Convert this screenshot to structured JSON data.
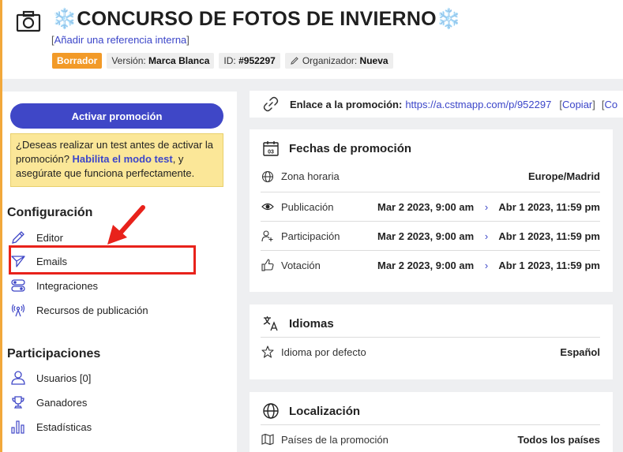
{
  "header": {
    "snow_left": "❄️",
    "title": "CONCURSO DE FOTOS DE INVIERNO",
    "snow_right": "❄️",
    "ref_open": "[",
    "ref_link": "Añadir una referencia interna",
    "ref_close": "]",
    "badges": {
      "draft": "Borrador",
      "version_label": "Versión:",
      "version_value": "Marca Blanca",
      "id_label": "ID:",
      "id_value": "#952297",
      "organizer_label": "Organizador:",
      "organizer_value": "Nueva"
    }
  },
  "sidebar": {
    "activate_label": "Activar promoción",
    "test_note": {
      "before": "¿Deseas realizar un test antes de activar la promoción? ",
      "link": "Habilita el modo test",
      "after": ", y asegúrate que funciona perfectamente."
    },
    "config_title": "Configuración",
    "config_items": [
      {
        "label": "Editor",
        "icon": "pencil-icon"
      },
      {
        "label": "Emails",
        "icon": "paper-plane-icon"
      },
      {
        "label": "Integraciones",
        "icon": "toggles-icon"
      },
      {
        "label": "Recursos de publicación",
        "icon": "broadcast-icon"
      }
    ],
    "participations_title": "Participaciones",
    "participation_items": [
      {
        "label": "Usuarios [0]",
        "icon": "user-icon"
      },
      {
        "label": "Ganadores",
        "icon": "trophy-icon"
      },
      {
        "label": "Estadísticas",
        "icon": "bar-chart-icon"
      }
    ]
  },
  "promo_link": {
    "label": "Enlace a la promoción:",
    "url": "https://a.cstmapp.com/p/952297",
    "copy": "Copiar",
    "extra": "Co"
  },
  "dates_card": {
    "title": "Fechas de promoción",
    "timezone_label": "Zona horaria",
    "timezone_value": "Europe/Madrid",
    "rows": [
      {
        "label": "Publicación",
        "from": "Mar 2 2023, 9:00 am",
        "to": "Abr 1 2023, 11:59 pm",
        "icon": "eye-icon"
      },
      {
        "label": "Participación",
        "from": "Mar 2 2023, 9:00 am",
        "to": "Abr 1 2023, 11:59 pm",
        "icon": "user-add-icon"
      },
      {
        "label": "Votación",
        "from": "Mar 2 2023, 9:00 am",
        "to": "Abr 1 2023, 11:59 pm",
        "icon": "thumbs-up-icon"
      }
    ],
    "arrow": "›"
  },
  "languages_card": {
    "title": "Idiomas",
    "default_label": "Idioma por defecto",
    "default_value": "Español"
  },
  "location_card": {
    "title": "Localización",
    "countries_label": "Países de la promoción",
    "countries_value": "Todos los países"
  },
  "colors": {
    "accent": "#3f47c7",
    "draft": "#f29a28",
    "highlight": "#e8221b",
    "note_bg": "#fbe798"
  }
}
